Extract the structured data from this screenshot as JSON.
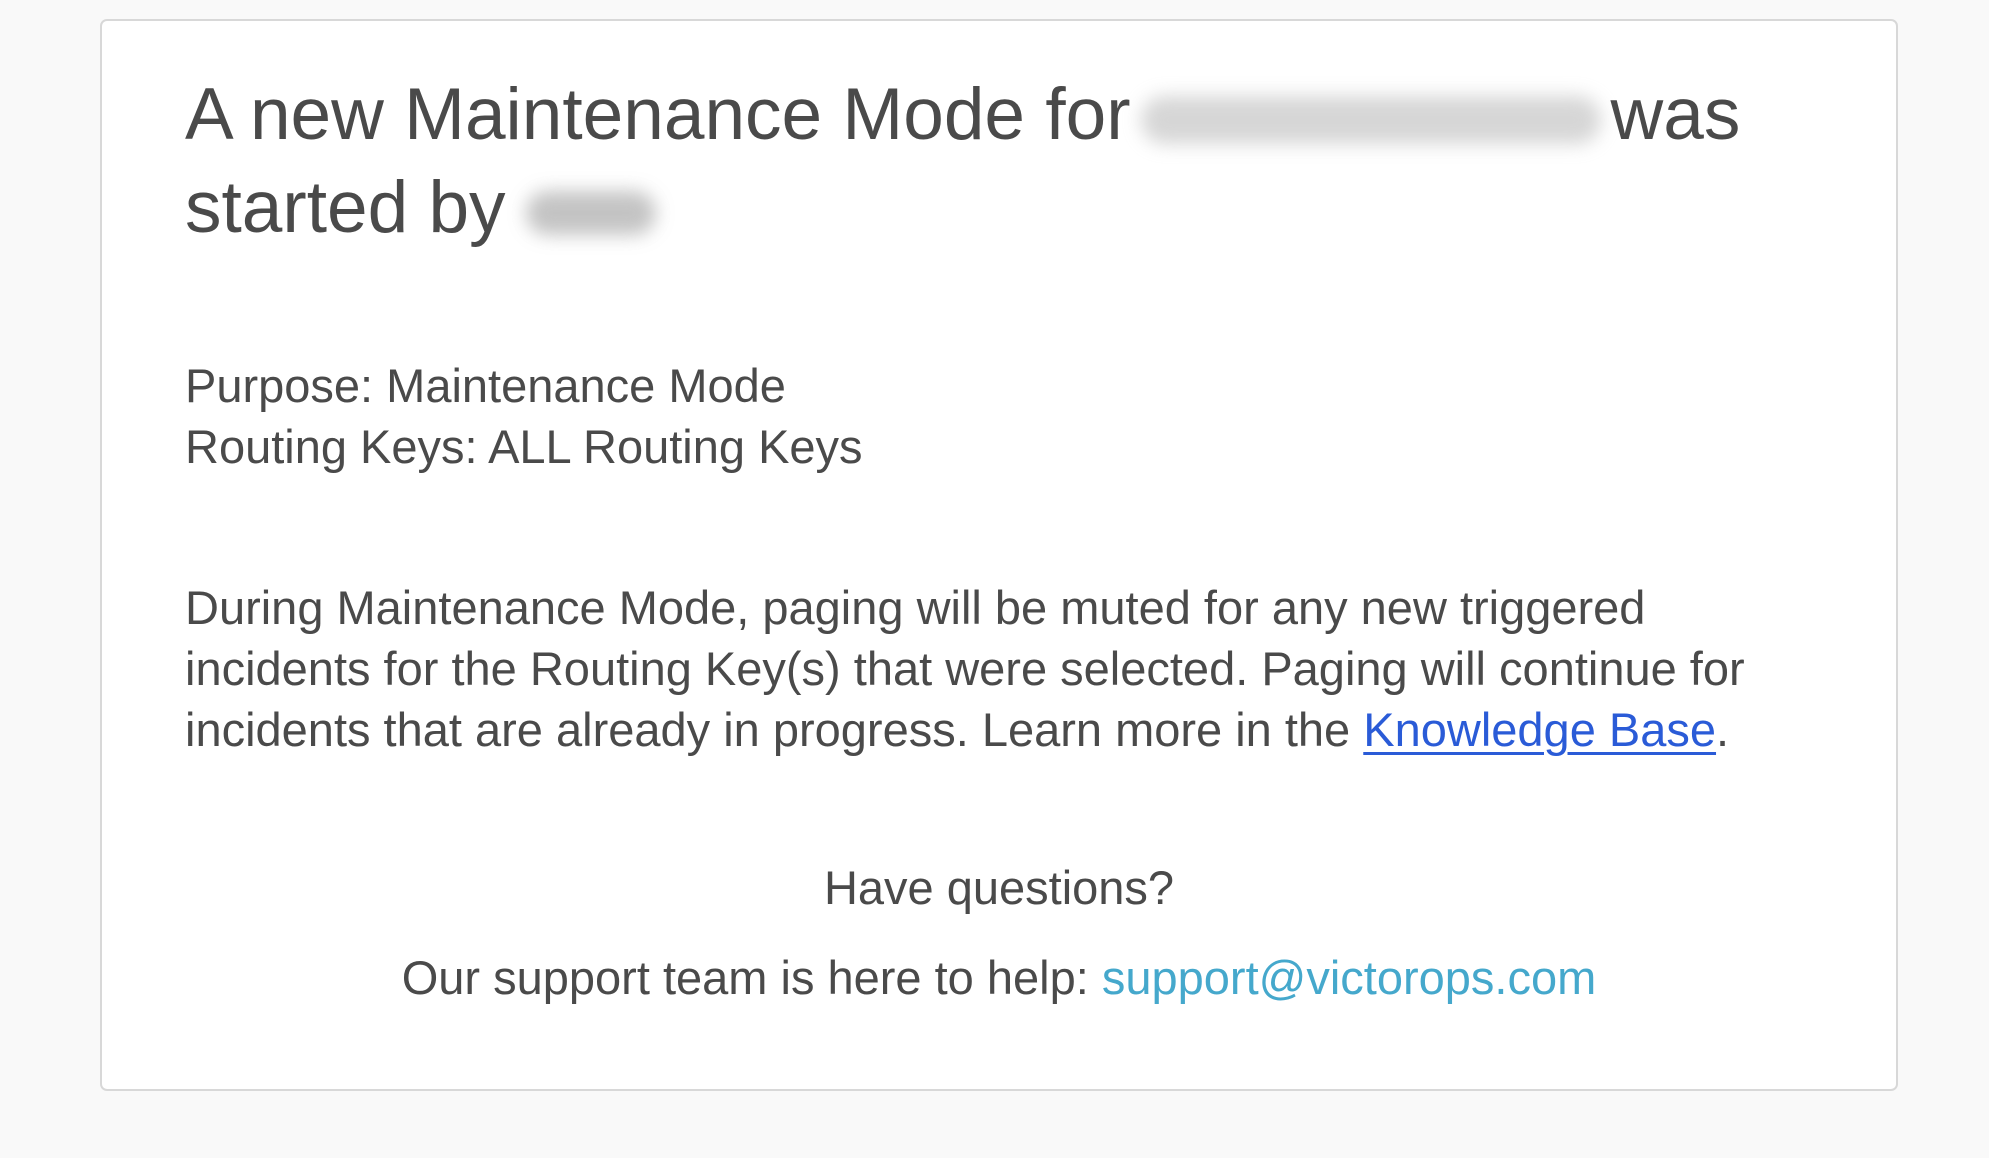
{
  "heading": {
    "part1": "A new Maintenance Mode for",
    "part2": "was started by"
  },
  "details": {
    "purpose": "Purpose: Maintenance Mode",
    "routing_keys": "Routing Keys: ALL Routing Keys"
  },
  "description": {
    "text": "During Maintenance Mode, paging will be muted for any new triggered incidents for the Routing Key(s) that were selected. Paging will continue for incidents that are already in progress. Learn more in the ",
    "link_label": "Knowledge Base",
    "suffix": "."
  },
  "support": {
    "question": "Have questions?",
    "text": "Our support team is here to help: ",
    "email": "support@victorops.com"
  },
  "colors": {
    "text": "#4a4a4a",
    "link": "#2a5bd7",
    "email": "#45a8cc",
    "background": "#f9f9f9"
  }
}
